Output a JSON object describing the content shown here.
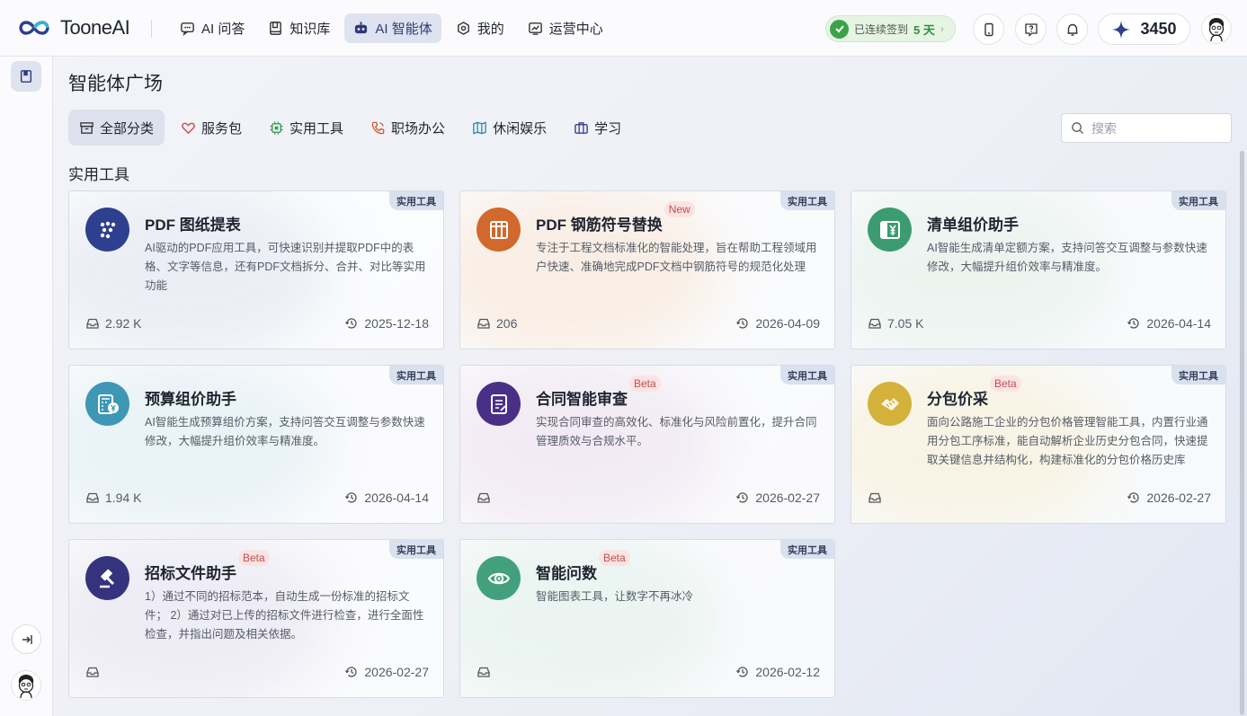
{
  "app": {
    "logo_text": "TooneAI"
  },
  "nav": [
    {
      "label": "AI 问答",
      "icon": "chat-icon",
      "active": false
    },
    {
      "label": "知识库",
      "icon": "book-icon",
      "active": false
    },
    {
      "label": "AI 智能体",
      "icon": "robot-icon",
      "active": true
    },
    {
      "label": "我的",
      "icon": "hexagon-icon",
      "active": false
    },
    {
      "label": "运营中心",
      "icon": "chart-icon",
      "active": false
    }
  ],
  "checkin": {
    "prefix": "已连续签到",
    "days": "5 天"
  },
  "points": {
    "value": "3450"
  },
  "page": {
    "title": "智能体广场",
    "section_title": "实用工具"
  },
  "search": {
    "placeholder": "搜索"
  },
  "categories": [
    {
      "label": "全部分类",
      "icon": "archive-icon",
      "active": true
    },
    {
      "label": "服务包",
      "icon": "heart-icon",
      "active": false
    },
    {
      "label": "实用工具",
      "icon": "chip-icon",
      "active": false
    },
    {
      "label": "职场办公",
      "icon": "phone-icon",
      "active": false
    },
    {
      "label": "休闲娱乐",
      "icon": "map-icon",
      "active": false
    },
    {
      "label": "学习",
      "icon": "briefcase-icon",
      "active": false
    }
  ],
  "cards": [
    {
      "title": "PDF 图纸提表",
      "badge": "",
      "tag": "实用工具",
      "desc": "AI驱动的PDF应用工具，可快速识别并提取PDF中的表格、文字等信息，还有PDF文档拆分、合并、对比等实用功能",
      "views": "2.92 K",
      "date": "2025-12-18",
      "icon": "dots-icon",
      "color": "#2e3f8f",
      "glow": "#dfe3ef"
    },
    {
      "title": "PDF 钢筋符号替换",
      "badge": "New",
      "tag": "实用工具",
      "desc": "专注于工程文档标准化的智能处理，旨在帮助工程领域用户快速、准确地完成PDF文档中钢筋符号的规范化处理",
      "views": "206",
      "date": "2026-04-09",
      "icon": "columns-icon",
      "color": "#d0692b",
      "glow": "#f8e4d2"
    },
    {
      "title": "清单组价助手",
      "badge": "",
      "tag": "实用工具",
      "desc": "AI智能生成清单定额方案，支持问答交互调整与参数快速修改，大幅提升组价效率与精准度。",
      "views": "7.05 K",
      "date": "2026-04-14",
      "icon": "yen-doc-icon",
      "color": "#3d9b72",
      "glow": "#e1f0e8"
    },
    {
      "title": "预算组价助手",
      "badge": "",
      "tag": "实用工具",
      "desc": "AI智能生成预算组价方案，支持问答交互调整与参数快速修改，大幅提升组价效率与精准度。",
      "views": "1.94 K",
      "date": "2026-04-14",
      "icon": "calc-yen-icon",
      "color": "#3d97b5",
      "glow": "#dcebf1"
    },
    {
      "title": "合同智能审查",
      "badge": "Beta",
      "tag": "实用工具",
      "desc": "实现合同审查的高效化、标准化与风险前置化，提升合同管理质效与合规水平。",
      "views": "",
      "date": "2026-02-27",
      "icon": "contract-icon",
      "color": "#4a2f86",
      "glow": "#ecdfee"
    },
    {
      "title": "分包价采",
      "badge": "Beta",
      "tag": "实用工具",
      "desc": "面向公路施工企业的分包价格管理智能工具，内置行业通用分包工序标准，能自动解析企业历史分包合同，快速提取关键信息并结构化，构建标准化的分包价格历史库",
      "views": "",
      "date": "2026-02-27",
      "icon": "handshake-icon",
      "color": "#d4b13a",
      "glow": "#f7efd2"
    },
    {
      "title": "招标文件助手",
      "badge": "Beta",
      "tag": "实用工具",
      "desc": "1）通过不同的招标范本，自动生成一份标准的招标文件；  2）通过对已上传的招标文件进行检查，进行全面性检查，并指出问题及相关依据。",
      "views": "",
      "date": "2026-02-27",
      "icon": "gavel-icon",
      "color": "#35337d",
      "glow": "#e4e0ee"
    },
    {
      "title": "智能问数",
      "badge": "Beta",
      "tag": "实用工具",
      "desc": "智能图表工具，让数字不再冰冷",
      "views": "",
      "date": "2026-02-12",
      "icon": "eye-icon",
      "color": "#43a07e",
      "glow": "#dfefe8"
    }
  ]
}
